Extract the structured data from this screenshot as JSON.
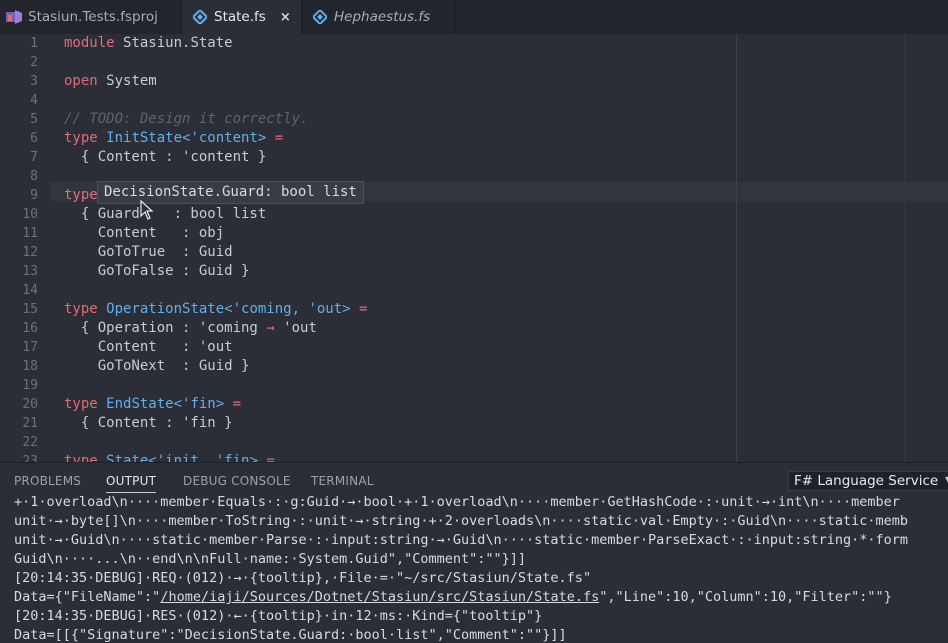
{
  "tabs": [
    {
      "name": "Stasiun.Tests.fsproj",
      "icon": "fsproj-icon",
      "active": false,
      "italic": false
    },
    {
      "name": "State.fs",
      "icon": "fsharp-file-icon",
      "active": true,
      "italic": false,
      "close": "×"
    },
    {
      "name": "Hephaestus.fs",
      "icon": "fsharp-file-icon",
      "active": false,
      "italic": true
    }
  ],
  "editor": {
    "line_numbers": [
      "1",
      "2",
      "3",
      "4",
      "5",
      "6",
      "7",
      "8",
      "9",
      "10",
      "11",
      "12",
      "13",
      "14",
      "15",
      "16",
      "17",
      "18",
      "19",
      "20",
      "21",
      "22",
      "23"
    ],
    "lines": [
      {
        "n": 1,
        "tokens": [
          [
            "kw",
            "module"
          ],
          [
            "",
            "·"
          ],
          [
            "",
            "Stasiun.State"
          ]
        ]
      },
      {
        "n": 2,
        "tokens": []
      },
      {
        "n": 3,
        "tokens": [
          [
            "kw",
            "open"
          ],
          [
            "",
            "·"
          ],
          [
            "",
            "System"
          ]
        ]
      },
      {
        "n": 4,
        "tokens": []
      },
      {
        "n": 5,
        "tokens": [
          [
            "cm",
            "//·TODO:·Design·it·correctly."
          ]
        ]
      },
      {
        "n": 6,
        "tokens": [
          [
            "kw",
            "type"
          ],
          [
            "",
            "·"
          ],
          [
            "ty",
            "InitState<'content>"
          ],
          [
            "",
            "·"
          ],
          [
            "op",
            "="
          ]
        ]
      },
      {
        "n": 7,
        "tokens": [
          [
            "ws",
            "··"
          ],
          [
            "",
            "{·Content·:·'content·}"
          ]
        ]
      },
      {
        "n": 8,
        "tokens": []
      },
      {
        "n": 9,
        "tokens": [
          [
            "kw",
            "type"
          ]
        ]
      },
      {
        "n": 10,
        "tokens": [
          [
            "ws",
            "··"
          ],
          [
            "",
            "{·Guard····:·bool·list"
          ]
        ]
      },
      {
        "n": 11,
        "tokens": [
          [
            "ws",
            "····"
          ],
          [
            "",
            "Content···:·obj"
          ]
        ]
      },
      {
        "n": 12,
        "tokens": [
          [
            "ws",
            "····"
          ],
          [
            "",
            "GoToTrue··:·Guid"
          ]
        ]
      },
      {
        "n": 13,
        "tokens": [
          [
            "ws",
            "····"
          ],
          [
            "",
            "GoToFalse·:·Guid·}"
          ]
        ]
      },
      {
        "n": 14,
        "tokens": []
      },
      {
        "n": 15,
        "tokens": [
          [
            "kw",
            "type"
          ],
          [
            "",
            "·"
          ],
          [
            "ty",
            "OperationState<'coming,·'out>"
          ],
          [
            "",
            "·"
          ],
          [
            "op",
            "="
          ]
        ]
      },
      {
        "n": 16,
        "tokens": [
          [
            "ws",
            "··"
          ],
          [
            "",
            "{·Operation·:·'coming·"
          ],
          [
            "op",
            "→"
          ],
          [
            "",
            "·'out"
          ]
        ]
      },
      {
        "n": 17,
        "tokens": [
          [
            "ws",
            "····"
          ],
          [
            "",
            "Content···:·'out"
          ]
        ]
      },
      {
        "n": 18,
        "tokens": [
          [
            "ws",
            "····"
          ],
          [
            "",
            "GoToNext··:·Guid·}"
          ]
        ]
      },
      {
        "n": 19,
        "tokens": []
      },
      {
        "n": 20,
        "tokens": [
          [
            "kw",
            "type"
          ],
          [
            "",
            "·"
          ],
          [
            "ty",
            "EndState<'fin>"
          ],
          [
            "",
            "·"
          ],
          [
            "op",
            "="
          ]
        ]
      },
      {
        "n": 21,
        "tokens": [
          [
            "ws",
            "··"
          ],
          [
            "",
            "{·Content·:·'fin·}"
          ]
        ]
      },
      {
        "n": 22,
        "tokens": []
      },
      {
        "n": 23,
        "tokens": [
          [
            "kw",
            "type"
          ],
          [
            "",
            "·"
          ],
          [
            "ty",
            "State<'init,·'fin>"
          ],
          [
            "",
            "·"
          ],
          [
            "op",
            "="
          ]
        ]
      }
    ],
    "tooltip": "DecisionState.Guard: bool list"
  },
  "panel": {
    "tabs": [
      "PROBLEMS",
      "OUTPUT",
      "DEBUG CONSOLE",
      "TERMINAL"
    ],
    "active_tab": "OUTPUT",
    "channel": "F# Language Service",
    "output_lines": [
      "+·1·overload\\n····member·Equals·:·g:Guid·→·bool·+·1·overload\\n····member·GetHashCode·:·unit·→·int\\n····member",
      "unit·→·byte[]\\n····member·ToString·:·unit·→·string·+·2·overloads\\n····static·val·Empty·:·Guid\\n····static·memb",
      "unit·→·Guid\\n····static·member·Parse·:·input:string·→·Guid\\n····static·member·ParseExact·:·input:string·*·form",
      "Guid\\n····...\\n··end\\n\\nFull·name:·System.Guid\",\"Comment\":\"\"}]]",
      "[20:14:35·DEBUG]·REQ·(012)·→·{tooltip},·File·=·\"~/src/Stasiun/State.fs\""
    ],
    "data_line": {
      "prefix": "Data={\"FileName\":\"",
      "link": "/home/iaji/Sources/Dotnet/Stasiun/src/Stasiun/State.fs",
      "suffix": "\",\"Line\":10,\"Column\":10,\"Filter\":\"\"}"
    },
    "output_tail": [
      "[20:14:35·DEBUG]·RES·(012)·←·{tooltip}·in·12·ms:·Kind={\"tooltip\"}",
      "Data=[[{\"Signature\":\"DecisionState.Guard:·bool·list\",\"Comment\":\"\"}]]"
    ]
  },
  "colors": {
    "keyword": "#e06c75",
    "type": "#61afef",
    "comment": "#5c6370",
    "background": "#2b2e36"
  }
}
